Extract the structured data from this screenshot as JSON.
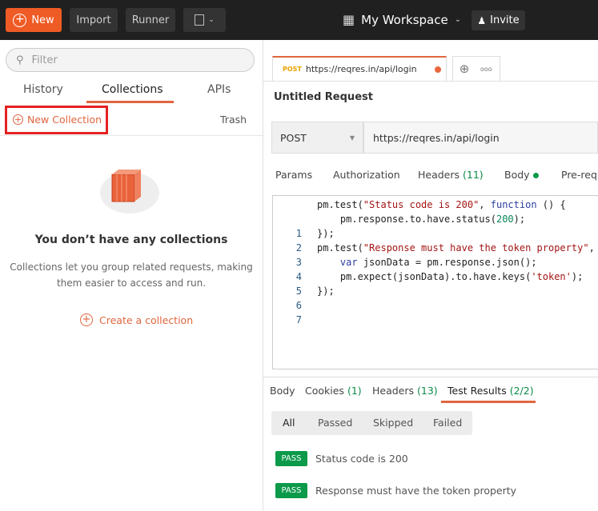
{
  "topbar": {
    "new": "New",
    "import": "Import",
    "runner": "Runner",
    "workspace": "My Workspace",
    "invite": "Invite"
  },
  "sidebar": {
    "filter_placeholder": "Filter",
    "tabs": [
      "History",
      "Collections",
      "APIs"
    ],
    "active_tab": "Collections",
    "new_collection": "New Collection",
    "trash": "Trash",
    "empty_title": "You don’t have any collections",
    "empty_desc_1": "Collections let you group related requests, making",
    "empty_desc_2": "them easier to access and run.",
    "create": "Create a collection"
  },
  "request_tab": {
    "method": "POST",
    "url": "https://reqres.in/api/login"
  },
  "request": {
    "title": "Untitled Request",
    "method": "POST",
    "url": "https://reqres.in/api/login",
    "tabs": {
      "params": "Params",
      "authorization": "Authorization",
      "headers": "Headers",
      "headers_count": "(11)",
      "body": "Body",
      "prerequest": "Pre-requ"
    }
  },
  "editor": {
    "line_numbers": [
      "1",
      "2",
      "3",
      "4",
      "5",
      "6",
      "7"
    ]
  },
  "response": {
    "tabs": {
      "body": "Body",
      "cookies": "Cookies",
      "cookies_count": "(1)",
      "headers": "Headers",
      "headers_count": "(13)",
      "tests": "Test Results",
      "tests_count": "(2/2)"
    },
    "filters": [
      "All",
      "Passed",
      "Skipped",
      "Failed"
    ],
    "results": [
      {
        "status": "PASS",
        "name": "Status code is 200"
      },
      {
        "status": "PASS",
        "name": "Response must have the token property"
      }
    ]
  },
  "colors": {
    "accent": "#ef5b25",
    "pass": "#0b9a4a",
    "highlight_box": "#e52222"
  }
}
